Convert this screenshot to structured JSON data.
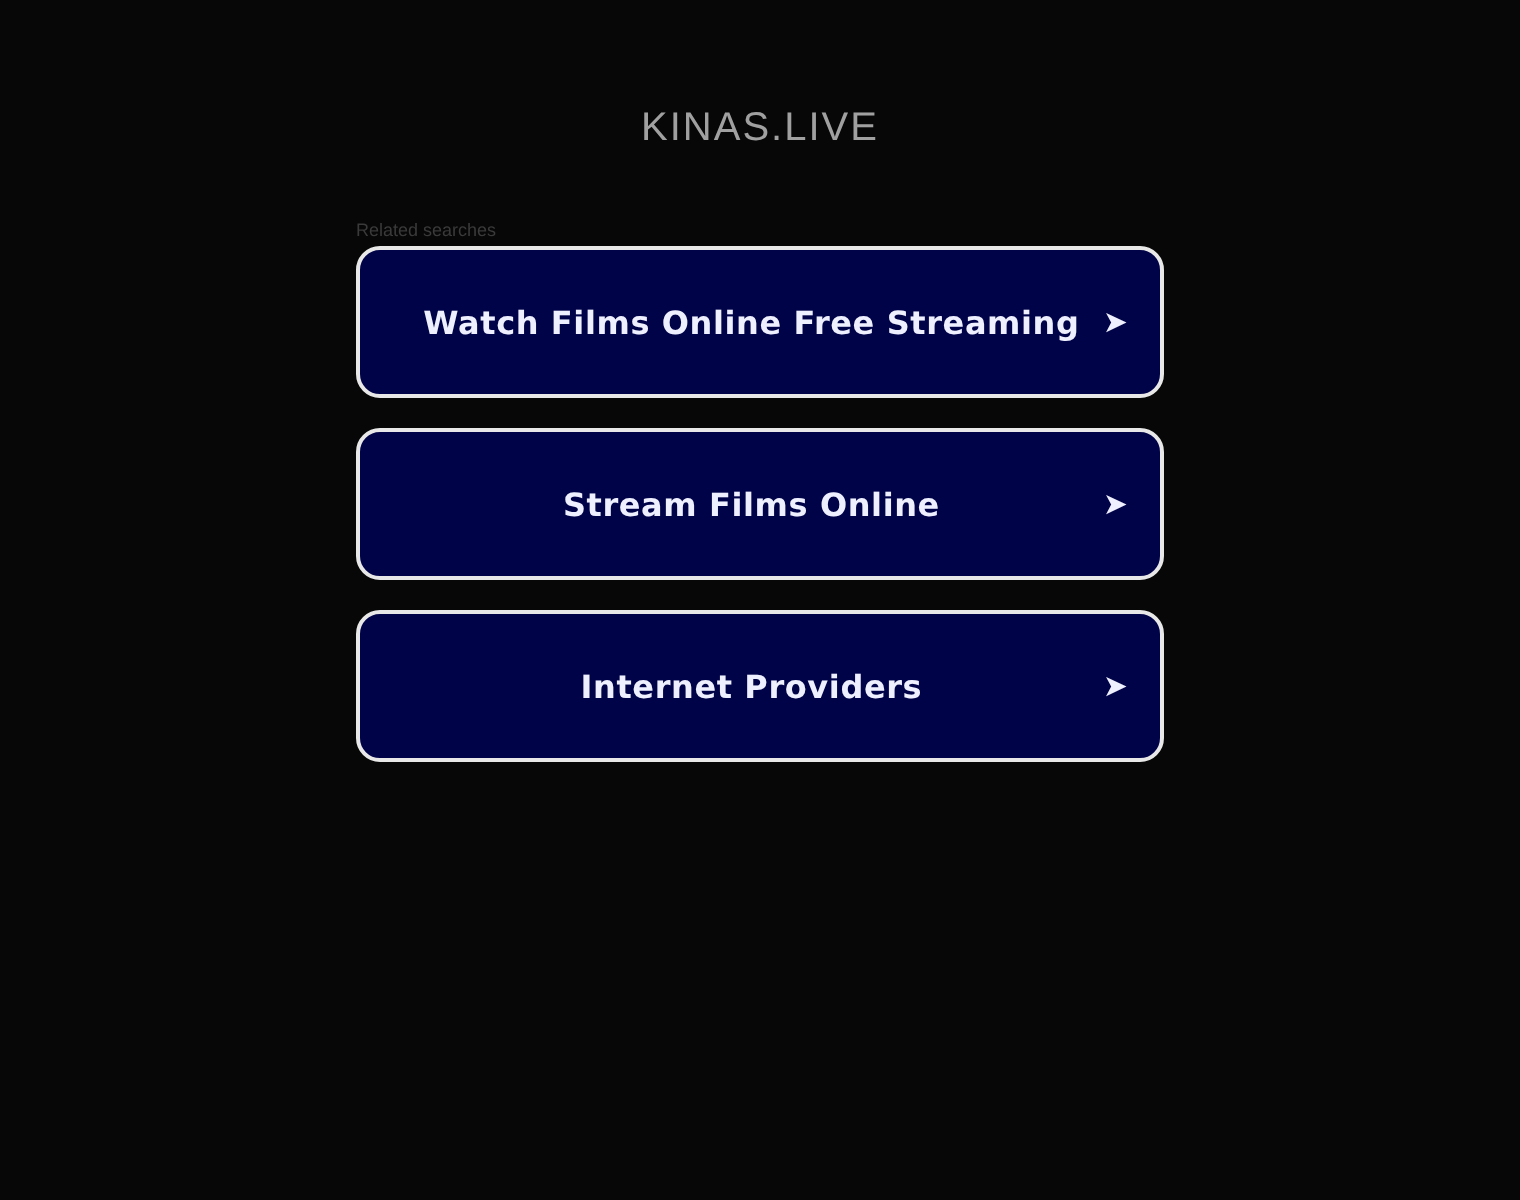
{
  "site_title": "KINAS.LIVE",
  "related": {
    "heading": "Related searches",
    "links": [
      {
        "label": "Watch Films Online Free Streaming",
        "arrow": "➤"
      },
      {
        "label": "Stream Films Online",
        "arrow": "➤"
      },
      {
        "label": "Internet Providers",
        "arrow": "➤"
      }
    ]
  }
}
